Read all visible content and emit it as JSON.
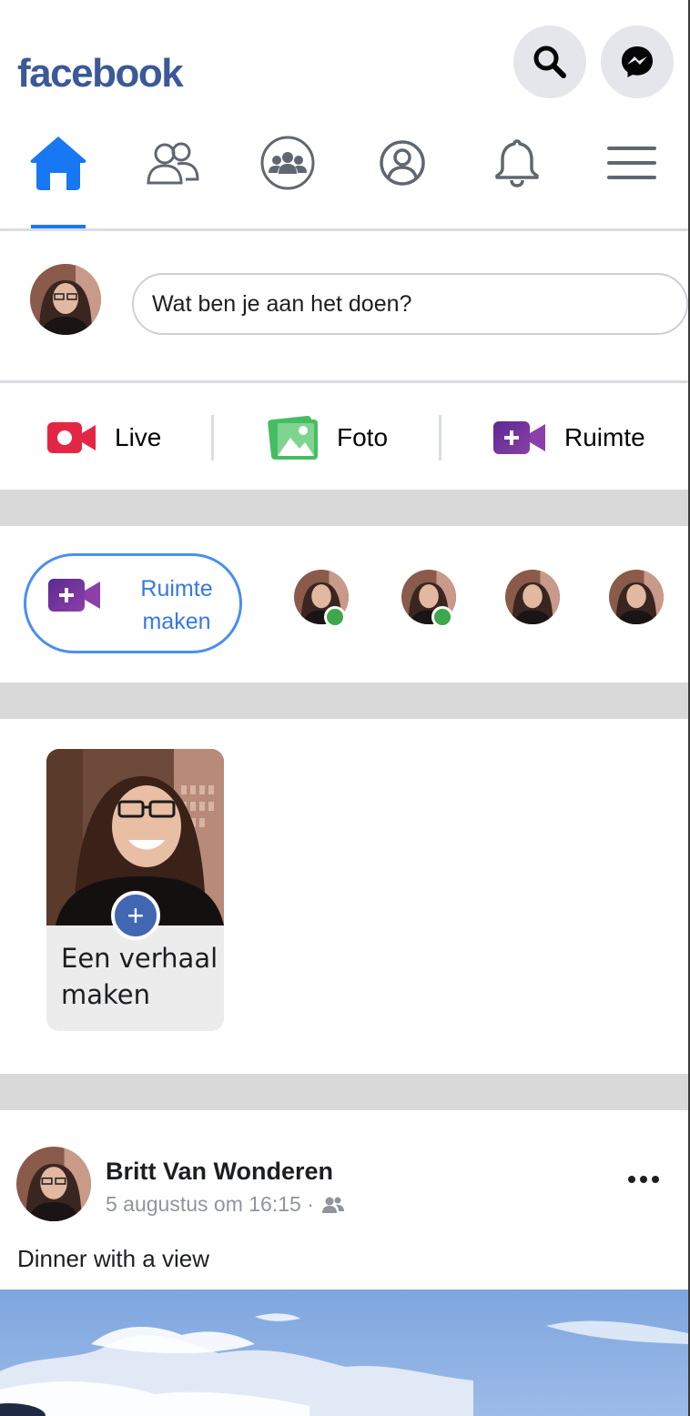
{
  "header": {
    "logo": "facebook",
    "search_icon": "search-icon",
    "messenger_icon": "messenger-icon"
  },
  "nav": {
    "items": [
      {
        "name": "home",
        "icon": "home-icon",
        "active": true
      },
      {
        "name": "friends",
        "icon": "friends-icon",
        "active": false
      },
      {
        "name": "groups",
        "icon": "groups-icon",
        "active": false
      },
      {
        "name": "profile",
        "icon": "profile-icon",
        "active": false
      },
      {
        "name": "notifications",
        "icon": "bell-icon",
        "active": false
      },
      {
        "name": "menu",
        "icon": "menu-icon",
        "active": false
      }
    ],
    "active_color": "#1877f2"
  },
  "composer": {
    "placeholder": "Wat ben je aan het doen?"
  },
  "actions": {
    "live": "Live",
    "photo": "Foto",
    "room": "Ruimte"
  },
  "rooms": {
    "create_label_line1": "Ruimte",
    "create_label_line2": "maken",
    "contacts": [
      {
        "online": true
      },
      {
        "online": true
      },
      {
        "online": false
      },
      {
        "online": false
      }
    ]
  },
  "stories": {
    "create_line1": "Een verhaal",
    "create_line2": "maken"
  },
  "post": {
    "author": "Britt Van Wonderen",
    "timestamp": "5 augustus om 16:15 ·",
    "audience_icon": "friends-audience-icon",
    "text": "Dinner with a view"
  },
  "colors": {
    "brand": "#3b5998",
    "accent": "#1877f2",
    "online": "#3ea64c",
    "live_red": "#e42645",
    "photo_green": "#45bd62",
    "room_purple": "#6b2fa0"
  }
}
